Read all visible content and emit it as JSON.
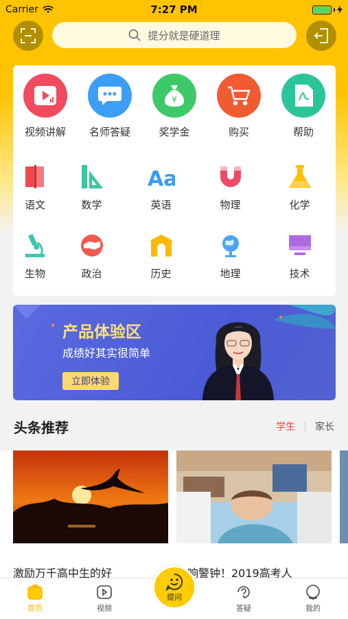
{
  "status_bar": {
    "carrier": "Carrier",
    "time": "7:27 PM",
    "battery_level": 1.0
  },
  "search": {
    "placeholder": "提分就是硬道理"
  },
  "quick_actions": [
    {
      "label": "视频讲解",
      "icon": "video-icon",
      "color": "#f24a5f"
    },
    {
      "label": "名师答疑",
      "icon": "chat-icon",
      "color": "#3d9ef5"
    },
    {
      "label": "奖学金",
      "icon": "money-bag-icon",
      "color": "#3dc968"
    },
    {
      "label": "购买",
      "icon": "cart-icon",
      "color": "#f25a32"
    },
    {
      "label": "帮助",
      "icon": "help-doc-icon",
      "color": "#2cc59a"
    }
  ],
  "subjects_row1": [
    {
      "label": "语文",
      "icon": "book-icon",
      "color": "#f04a50"
    },
    {
      "label": "数学",
      "icon": "ruler-icon",
      "color": "#3cc6a0"
    },
    {
      "label": "英语",
      "icon": "letters-icon",
      "color": "#3a9cf0"
    },
    {
      "label": "物理",
      "icon": "magnet-icon",
      "color": "#f04a6a"
    },
    {
      "label": "化学",
      "icon": "flask-icon",
      "color": "#ffbf00"
    }
  ],
  "subjects_row2": [
    {
      "label": "生物",
      "icon": "microscope-icon",
      "color": "#3cc6b0"
    },
    {
      "label": "政治",
      "icon": "handshake-icon",
      "color": "#f05a50"
    },
    {
      "label": "历史",
      "icon": "gate-icon",
      "color": "#ffb800"
    },
    {
      "label": "地理",
      "icon": "globe-icon",
      "color": "#4aa6f5"
    },
    {
      "label": "技术",
      "icon": "monitor-icon",
      "color": "#b06ae0"
    }
  ],
  "banner": {
    "title": "产品体验区",
    "subtitle": "成绩好其实很简单",
    "button": "立即体验"
  },
  "headlines": {
    "title": "头条推荐",
    "tab_student": "学生",
    "separator": "|",
    "tab_parent": "家长",
    "articles": [
      {
        "title": "激励万千高中生的好"
      },
      {
        "title": "敲响警钟！2019高考人"
      }
    ]
  },
  "tabbar": {
    "home": "首页",
    "video": "视频",
    "ask": "提问",
    "answer": "答疑",
    "mine": "我的"
  },
  "colors": {
    "primary": "#ffc300",
    "accent_red": "#e8453c",
    "banner_blue": "#4b5bd6"
  }
}
